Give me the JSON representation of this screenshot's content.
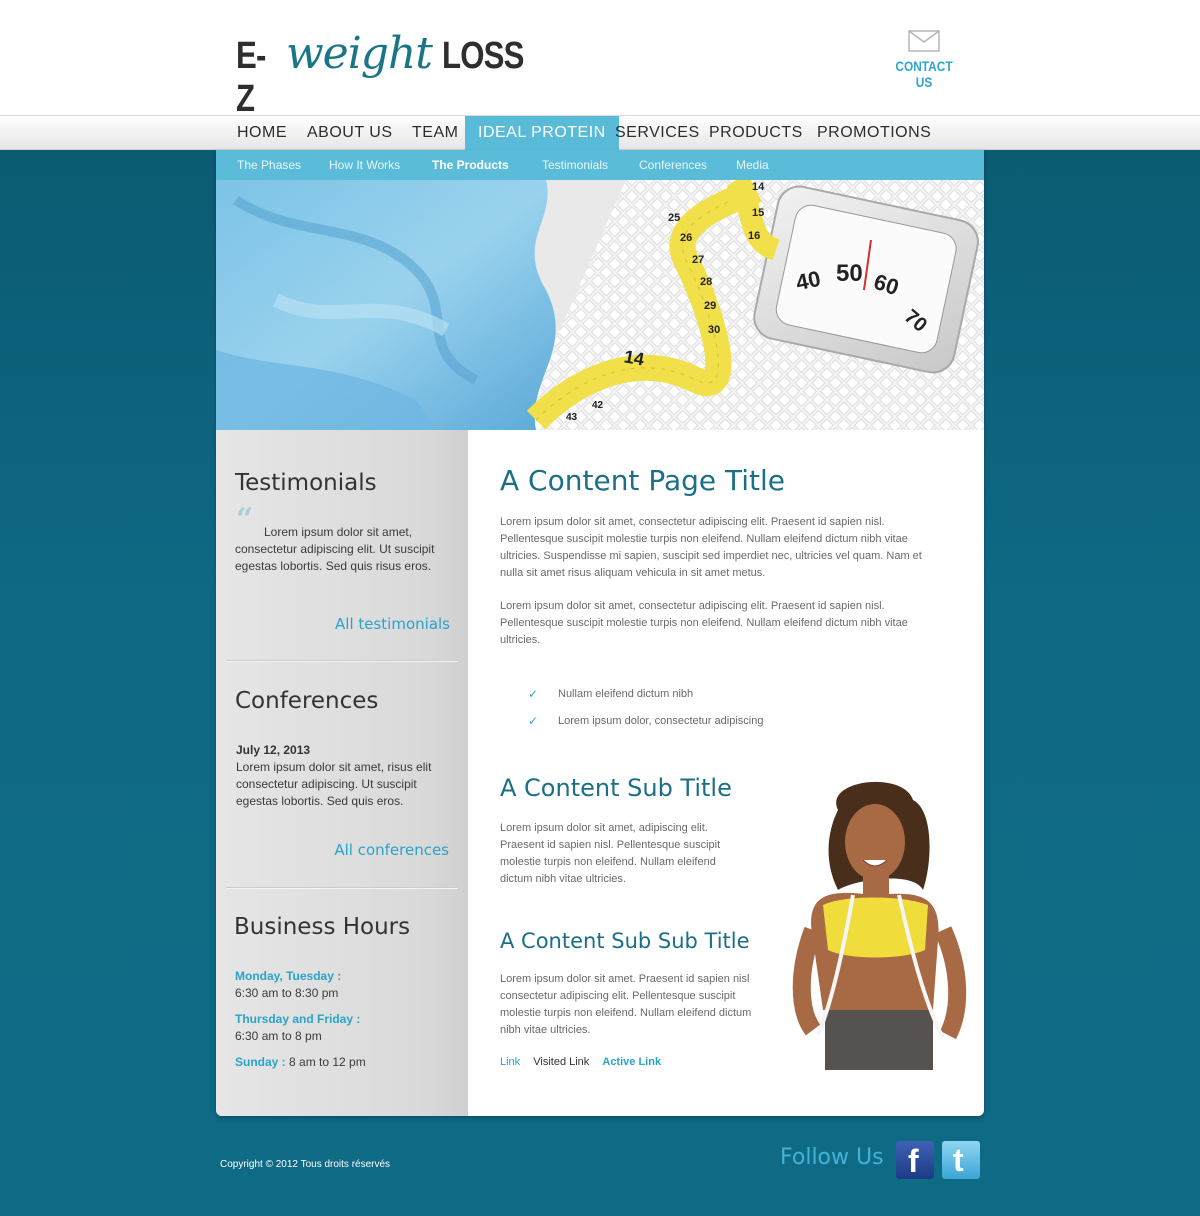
{
  "brand": {
    "part1": "E-Z",
    "part2": "weight",
    "part3": "LOSS",
    "accent_color": "#1a7686",
    "link_color": "#2aa3c9"
  },
  "header": {
    "contact_label": "CONTACT US",
    "contact_icon": "envelope-icon"
  },
  "nav": {
    "items": [
      "HOME",
      "ABOUT US",
      "TEAM",
      "IDEAL PROTEIN",
      "SERVICES",
      "PRODUCTS",
      "PROMOTIONS"
    ],
    "active": "IDEAL PROTEIN"
  },
  "subnav": {
    "items": [
      "The Phases",
      "How It Works",
      "The Products",
      "Testimonials",
      "Conferences",
      "Media"
    ],
    "active": "The Products"
  },
  "hero": {
    "scale_numbers": [
      "40",
      "50",
      "60",
      "70"
    ],
    "tape_numbers": [
      "14",
      "15",
      "16",
      "25",
      "26",
      "27",
      "28",
      "29",
      "30",
      "14",
      "42",
      "43"
    ]
  },
  "sidebar": {
    "testimonials": {
      "title": "Testimonials",
      "text": "Lorem ipsum dolor sit amet, consectetur adipiscing elit. Ut suscipit egestas lobortis. Sed quis risus eros.",
      "link": "All testimonials"
    },
    "conferences": {
      "title": "Conferences",
      "date": "July 12, 2013",
      "text": "Lorem ipsum dolor sit amet, risus elit consectetur adipiscing. Ut suscipit egestas lobortis. Sed quis eros.",
      "link": "All conferences"
    },
    "hours": {
      "title": "Business Hours",
      "row1_label": "Monday, Tuesday :",
      "row1_time": "6:30 am to 8:30 pm",
      "row2_label": "Thursday and Friday :",
      "row2_time": "6:30 am to 8 pm",
      "row3_label": "Sunday :",
      "row3_time": " 8 am to 12 pm"
    }
  },
  "content": {
    "title": "A Content Page Title",
    "para1": "Lorem ipsum dolor sit amet, consectetur adipiscing elit. Praesent id sapien nisl. Pellentesque suscipit molestie turpis non eleifend. Nullam eleifend dictum nibh vitae ultricies. Suspendisse mi sapien, suscipit sed imperdiet nec, ultricies vel quam. Nam et nulla sit amet risus aliquam vehicula in sit amet metus.",
    "para2": "Lorem ipsum dolor sit amet, consectetur adipiscing elit. Praesent id sapien nisl. Pellentesque suscipit molestie turpis non eleifend. Nullam eleifend dictum nibh vitae ultricies.",
    "checklist": [
      "Nullam eleifend dictum nibh",
      "Lorem ipsum dolor, consectetur adipiscing"
    ],
    "subtitle": "A Content Sub Title",
    "para3": "Lorem ipsum dolor sit amet, adipiscing elit. Praesent id sapien nisl. Pellentesque suscipit molestie turpis non eleifend. Nullam eleifend dictum nibh vitae ultricies.",
    "subsubtitle": "A Content Sub Sub Title",
    "para4": "Lorem ipsum dolor sit amet. Praesent id sapien nisl consectetur adipiscing elit. Pellentesque suscipit molestie turpis non eleifend. Nullam eleifend dictum nibh vitae ultricies.",
    "links": {
      "link": "Link",
      "visited": "Visited Link",
      "active": "Active Link"
    }
  },
  "footer": {
    "copyright": "Copyright © 2012 Tous droits réservés",
    "follow": "Follow Us",
    "social": [
      "facebook-icon",
      "twitter-icon"
    ]
  }
}
